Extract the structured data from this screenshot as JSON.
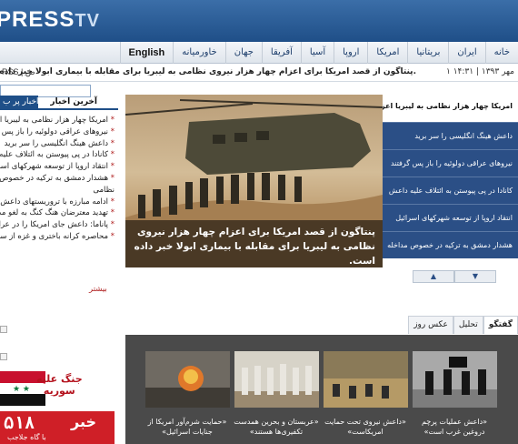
{
  "header": {
    "logo_main": "PRESS",
    "logo_tv": "TV"
  },
  "nav": {
    "items": [
      "خانه",
      "ایران",
      "بریتانیا",
      "امریکا",
      "اروپا",
      "آسیا",
      "آفریقا",
      "جهان",
      "خاورمیانه",
      "English"
    ]
  },
  "ticker": {
    "rss": "RSS | ص",
    "date": "۱ مهر ۱۳۹۳ | ۱۴:۳۱",
    "text": "پنتاگون از قصد امریکا برای اعزام چهار هزار نیروی نظامی به لیبریا برای مقابله با بیماری ابولا خبر داده است."
  },
  "left": {
    "tab_latest": "آخرین اخبار",
    "tab_popular": "اخبار پر ب",
    "latest": [
      "امریکا چهار هزار نظامی به لیبریا اعزام",
      "نیروهای عراقی دولوئیه را باز پس گرفتند",
      "داعش هینگ انگلیسی را سر برید",
      "کانادا در پی پیوستن به ائتلاف علیه داعش",
      "انتقاد اروپا از توسعه شهرکهای اسرائیل",
      "هشدار دمشق به ترکیه در خصوص مداخله",
      "نظامی",
      "ادامه مبارزه با تروریستهای داعش در",
      "تهدید معترضان هنگ کنگ به لغو مذاکره",
      "پاناما: داعش جای امریکا را در عراق گرفت",
      "محاصره کرانه باختری و غزه از سوی اسرائیل"
    ],
    "more": "بیشتر"
  },
  "hero": {
    "caption": "پنتاگون از قصد امریکا برای اعزام چهار هزار نیروی نظامی به لیبریا برای مقابله با بیماری ابولا خبر داده است."
  },
  "headlines": {
    "top": "امریکا چهار هزار نظامی به لیبریا اعزام می‌کند",
    "items": [
      "داعش هینگ انگلیسی را سر برید",
      "نیروهای عراقی دولوئیه را باز پس گرفتند",
      "کانادا در پی پیوستن به ائتلاف علیه داعش",
      "انتقاد اروپا از توسعه شهرکهای اسرائیل",
      "هشدار دمشق به ترکیه در خصوص مداخله"
    ]
  },
  "bottom_tabs": [
    "گفتگو",
    "تحلیل",
    "عکس روز"
  ],
  "gallery": {
    "captions": [
      "«داعش عملیات پرچم دروغین غرب است»",
      "«داعش نیروی تحت حمایت امریکاست»",
      "«عربستان و بحرین همدست تکفیری‌ها هستند»",
      "«حمایت شرم‌آور امریکا از جنایات اسرائیل»"
    ]
  },
  "ads": {
    "war_line1": "جنگ علیه",
    "war_line2": "سوریه",
    "code": "۵۱۸",
    "news": "خبر",
    "news_sub": "با گاه جلاجب"
  },
  "colors": {
    "nav_blue": "#1f4f88",
    "headline_blue": "#2b4f86",
    "accent_red": "#b02020",
    "gallery_bg": "#4a4a4a"
  }
}
